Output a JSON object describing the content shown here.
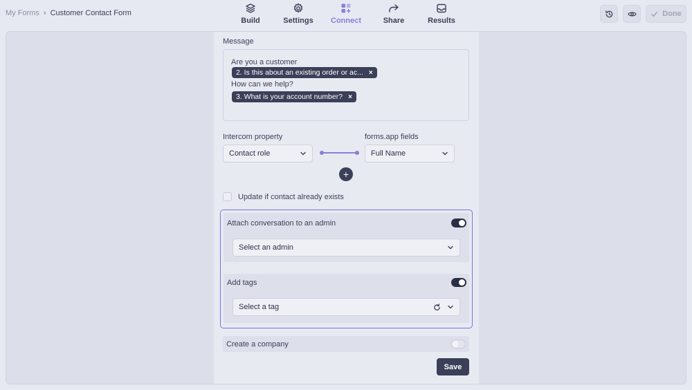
{
  "breadcrumb": {
    "root": "My Forms",
    "separator": "›",
    "current": "Customer Contact Form"
  },
  "nav": {
    "tabs": [
      {
        "label": "Build",
        "icon": "layers-icon",
        "active": false
      },
      {
        "label": "Settings",
        "icon": "gear-icon",
        "active": false
      },
      {
        "label": "Connect",
        "icon": "grid-plus-icon",
        "active": true
      },
      {
        "label": "Share",
        "icon": "share-arrow-icon",
        "active": false
      },
      {
        "label": "Results",
        "icon": "inbox-icon",
        "active": false
      }
    ]
  },
  "toolbar": {
    "history_icon": "history-icon",
    "preview_icon": "eye-icon",
    "done_label": "Done"
  },
  "message": {
    "label": "Message",
    "line1": "Are you a customer",
    "chip1": "2. Is this about an existing order or ac...",
    "line2": "How can we help?",
    "chip2": "3. What is your account number?",
    "chip_remove": "×"
  },
  "mapping": {
    "left_label": "Intercom property",
    "right_label": "forms.app fields",
    "left_value": "Contact role",
    "right_value": "Full Name",
    "add_label": "+"
  },
  "update_contact": {
    "label": "Update if contact already exists",
    "checked": false
  },
  "attach": {
    "label": "Attach conversation to an admin",
    "enabled": true,
    "select_placeholder": "Select an admin"
  },
  "tags": {
    "label": "Add tags",
    "enabled": true,
    "select_placeholder": "Select a tag"
  },
  "company": {
    "label": "Create a company",
    "enabled": false
  },
  "save_label": "Save",
  "colors": {
    "accent": "#7c6fe0",
    "dark": "#3b3f57",
    "background": "#e7e9f2"
  }
}
